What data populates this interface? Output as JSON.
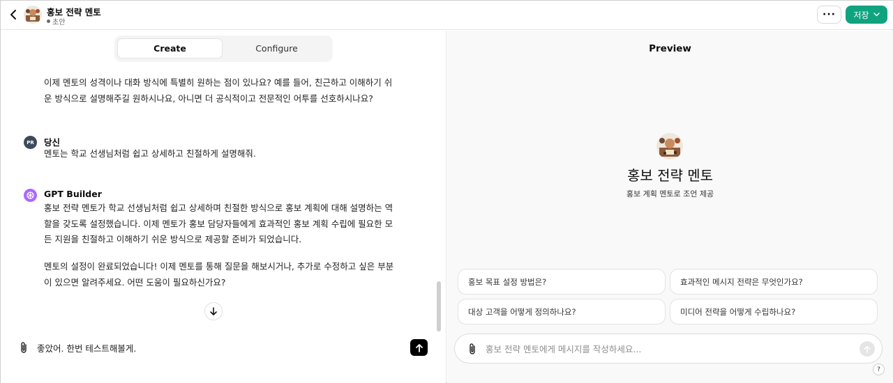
{
  "header": {
    "gpt_title": "홍보 전략 멘토",
    "status": "초안",
    "more_label": "···",
    "save_label": "저장"
  },
  "tabs": {
    "create": "Create",
    "configure": "Configure"
  },
  "chat": {
    "intro_line1": "이제 멘토의 성격이나 대화 방식에 특별히 원하는 점이 있나요? 예를 들어, 친근하고 이해하기 쉬",
    "intro_line2": "운 방식으로 설명해주길 원하시나요, 아니면 더 공식적이고 전문적인 어투를 선호하시나요?",
    "user": {
      "initials": "PR",
      "name": "당신",
      "text": "멘토는 학교 선생님처럼 쉽고 상세하고 친절하게 설명해줘."
    },
    "builder": {
      "name": "GPT Builder",
      "p1_line1": "홍보 전략 멘토가 학교 선생님처럼 쉽고 상세하며 친절한 방식으로 홍보 계획에 대해 설명하는 역",
      "p1_line2": "할을 갖도록 설정했습니다. 이제 멘토가 홍보 담당자들에게 효과적인 홍보 계획 수립에 필요한 모",
      "p1_line3": "든 지원을 친절하고 이해하기 쉬운 방식으로 제공할 준비가 되었습니다.",
      "p2_line1": "멘토의 설정이 완료되었습니다! 이제 멘토를 통해 질문을 해보시거나, 추가로 수정하고 싶은 부분",
      "p2_line2": "이 있으면 알려주세요. 어떤 도움이 필요하신가요?"
    },
    "composer_value": "좋았어. 한번 테스트해볼게."
  },
  "preview": {
    "title": "Preview",
    "gpt_name": "홍보 전략 멘토",
    "description": "홍보 계획 멘토로 조언 제공",
    "starters": [
      "홍보 목표 설정 방법은?",
      "효과적인 메시지 전략은 무엇인가요?",
      "대상 고객을 어떻게 정의하나요?",
      "미디어 전략을 어떻게 수립하나요?"
    ],
    "composer_placeholder": "홍보 전략 멘토에게 메시지를 작성하세요...",
    "help_label": "?"
  },
  "icons": {
    "back": "chevron-left-icon",
    "attach": "paperclip-icon",
    "send": "arrow-up-icon",
    "scroll_down": "arrow-down-icon",
    "builder": "openai-logo-icon"
  },
  "colors": {
    "accent": "#10a37f",
    "builder_icon": "#ab68ff",
    "user_avatar": "#3d4a5c"
  }
}
